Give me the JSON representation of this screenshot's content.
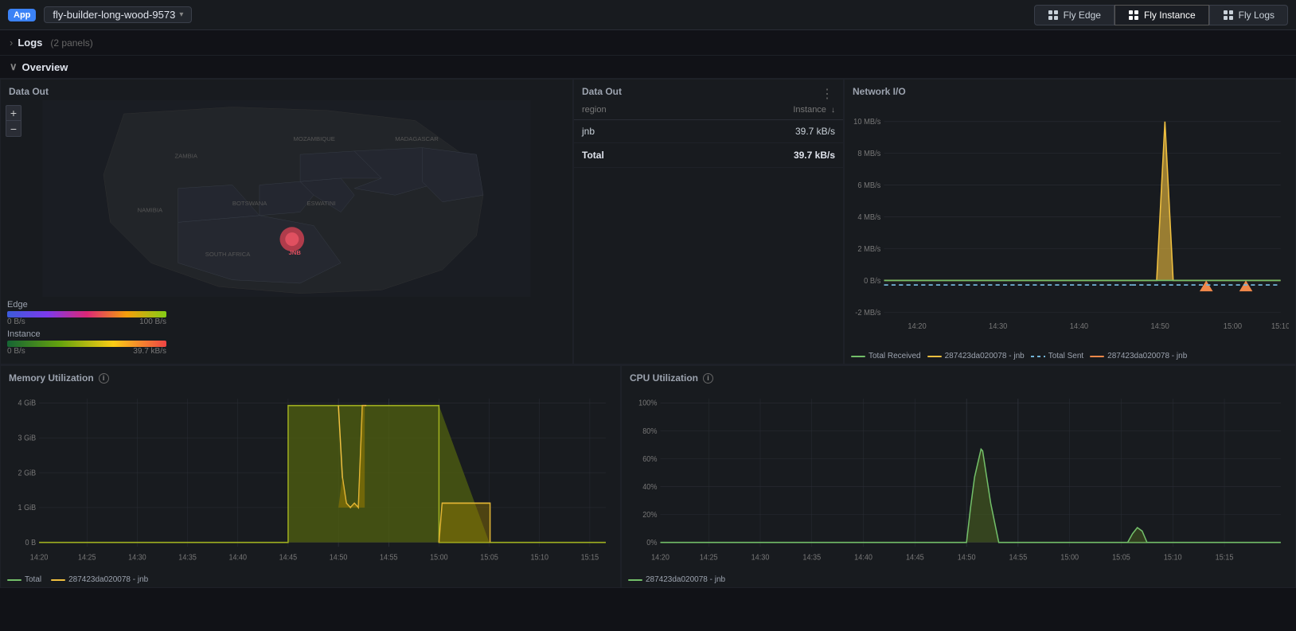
{
  "topbar": {
    "app_badge": "App",
    "app_name": "fly-builder-long-wood-9573",
    "tabs": [
      {
        "id": "fly-edge",
        "label": "Fly Edge",
        "icon": "grid"
      },
      {
        "id": "fly-instance",
        "label": "Fly Instance",
        "icon": "grid",
        "active": true
      },
      {
        "id": "fly-logs",
        "label": "Fly Logs",
        "icon": "grid"
      }
    ]
  },
  "logs_section": {
    "label": "Logs",
    "count": "(2 panels)"
  },
  "overview_section": {
    "label": "Overview"
  },
  "data_out_map": {
    "title": "Data Out",
    "legend_edge_label": "Edge",
    "legend_edge_min": "0 B/s",
    "legend_edge_max": "100 B/s",
    "legend_instance_label": "Instance",
    "legend_instance_min": "0 B/s",
    "legend_instance_max": "39.7 kB/s",
    "zoom_in": "+",
    "zoom_out": "−"
  },
  "data_out_table": {
    "title": "Data Out",
    "col_region": "region",
    "col_instance": "Instance",
    "rows": [
      {
        "region": "jnb",
        "value": "39.7 kB/s"
      }
    ],
    "total_label": "Total",
    "total_value": "39.7 kB/s"
  },
  "network_io": {
    "title": "Network I/O",
    "y_labels": [
      "10 MB/s",
      "8 MB/s",
      "6 MB/s",
      "4 MB/s",
      "2 MB/s",
      "0 B/s",
      "-2 MB/s"
    ],
    "x_labels": [
      "14:20",
      "14:30",
      "14:40",
      "14:50",
      "15:00",
      "15:10"
    ],
    "legend": [
      {
        "color": "#73bf69",
        "label": "Total Received",
        "style": "solid"
      },
      {
        "color": "#f0c040",
        "label": "287423da020078 - jnb",
        "style": "solid"
      },
      {
        "color": "#73b5d8",
        "label": "Total Sent",
        "style": "dashed"
      },
      {
        "color": "#f0884a",
        "label": "287423da020078 - jnb",
        "style": "solid"
      }
    ]
  },
  "memory_utilization": {
    "title": "Memory Utilization",
    "y_labels": [
      "4 GiB",
      "3 GiB",
      "2 GiB",
      "1 GiB",
      "0 B"
    ],
    "x_labels": [
      "14:20",
      "14:25",
      "14:30",
      "14:35",
      "14:40",
      "14:45",
      "14:50",
      "14:55",
      "15:00",
      "15:05",
      "15:10",
      "15:15"
    ],
    "legend": [
      {
        "color": "#73bf69",
        "label": "Total",
        "style": "solid"
      },
      {
        "color": "#f0c040",
        "label": "287423da020078 - jnb",
        "style": "solid"
      }
    ]
  },
  "cpu_utilization": {
    "title": "CPU Utilization",
    "y_labels": [
      "100%",
      "80%",
      "60%",
      "40%",
      "20%",
      "0%"
    ],
    "x_labels": [
      "14:20",
      "14:25",
      "14:30",
      "14:35",
      "14:40",
      "14:45",
      "14:50",
      "14:55",
      "15:00",
      "15:05",
      "15:10",
      "15:15"
    ],
    "legend": [
      {
        "color": "#73bf69",
        "label": "287423da020078 - jnb",
        "style": "solid"
      }
    ]
  }
}
